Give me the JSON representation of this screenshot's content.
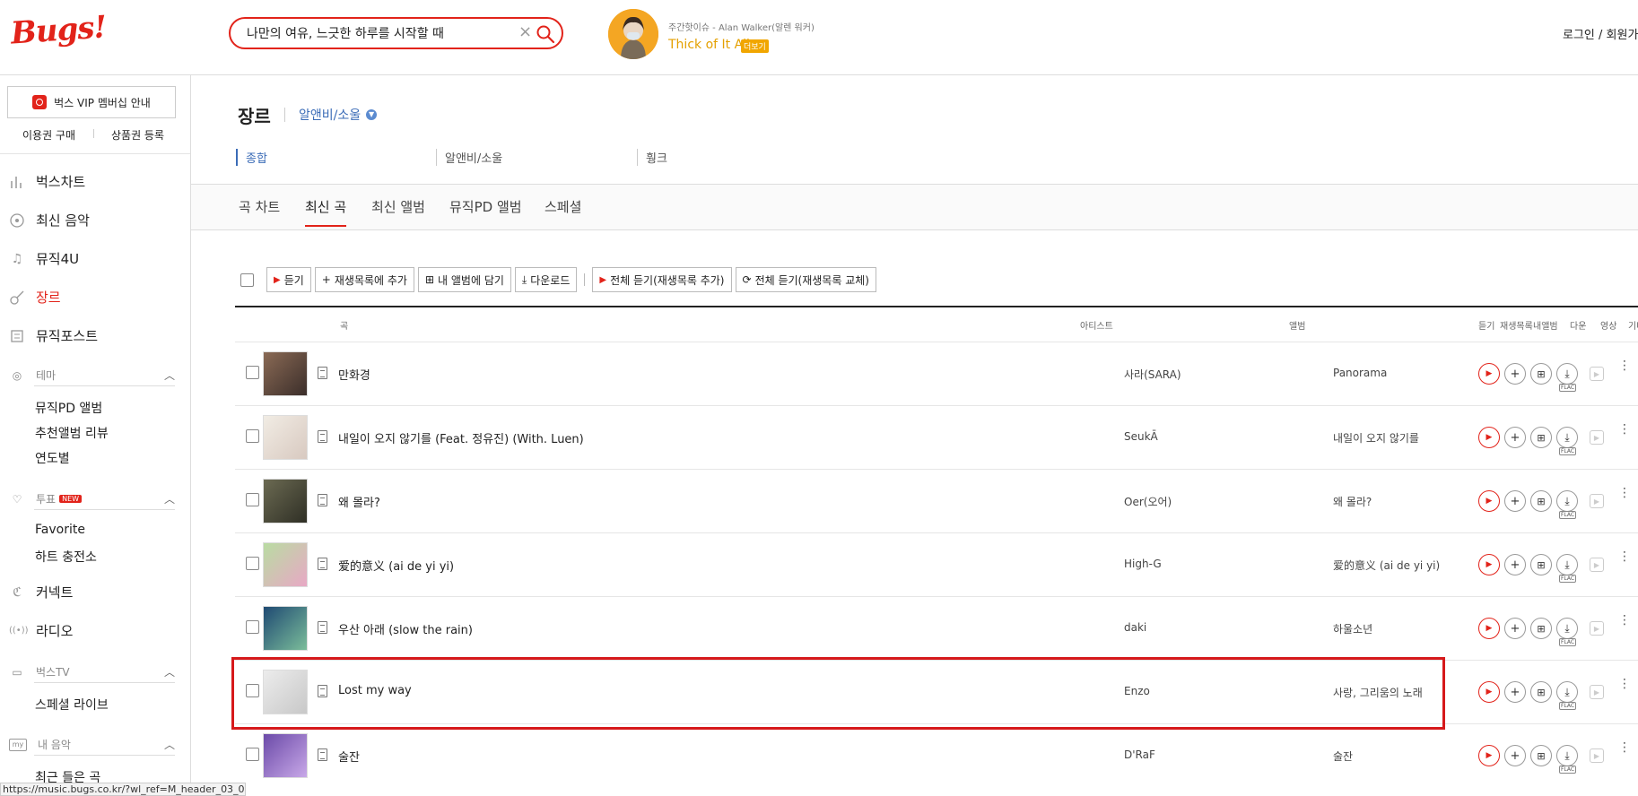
{
  "header": {
    "logo": "Bugs!",
    "search_value": "나만의 여유, 느긋한 하루를 시작할 때",
    "promo_sub": "주간핫이슈 - Alan Walker(알렌 워커)",
    "promo_title": "Thick of It All",
    "promo_more": "더보기",
    "login": "로그인 / 회원가입"
  },
  "sidebar": {
    "vip": "벅스 VIP 멤버십 안내",
    "purchase": "이용권 구매",
    "voucher": "상품권 등록",
    "menu": [
      {
        "label": "벅스차트",
        "icon": "chart-icon"
      },
      {
        "label": "최신 음악",
        "icon": "new-music-icon"
      },
      {
        "label": "뮤직4U",
        "icon": "note-icon"
      },
      {
        "label": "장르",
        "icon": "guitar-icon"
      },
      {
        "label": "뮤직포스트",
        "icon": "post-icon"
      }
    ],
    "theme": {
      "label": "테마",
      "items": [
        "뮤직PD 앨범",
        "추천앨범 리뷰",
        "연도별"
      ]
    },
    "vote": {
      "label": "투표",
      "badge": "NEW",
      "items": [
        "Favorite",
        "하트 충전소"
      ]
    },
    "connect": "커넥트",
    "radio": "라디오",
    "bugstv": {
      "label": "벅스TV",
      "items": [
        "스페셜 라이브"
      ]
    },
    "mymusic": {
      "label": "내 음악",
      "items": [
        "최근 들은 곡"
      ]
    },
    "status_url": "https://music.bugs.co.kr/?wl_ref=M_header_03_01"
  },
  "page": {
    "title": "장르",
    "genre": "알앤비/소울",
    "filters": [
      "종합",
      "알앤비/소울",
      "훵크"
    ],
    "tabs": [
      "곡 차트",
      "최신 곡",
      "최신 앨범",
      "뮤직PD 앨범",
      "스페셜"
    ]
  },
  "toolbar": {
    "listen": "듣기",
    "add_playlist": "재생목록에 추가",
    "add_album": "내 앨범에 담기",
    "download": "다운로드",
    "play_all_add": "전체 듣기(재생목록 추가)",
    "play_all_replace": "전체 듣기(재생목록 교체)"
  },
  "columns": {
    "song": "곡",
    "artist": "아티스트",
    "album": "앨범",
    "listen": "듣기",
    "playlist": "재생목록",
    "myalbum": "내앨범",
    "download": "다운",
    "video": "영상",
    "etc": "기타"
  },
  "tracks": [
    {
      "title": "만화경",
      "artist": "사라(SARA)",
      "album": "Panorama",
      "thumb": [
        "#8a6a55",
        "#3b2e2a"
      ]
    },
    {
      "title": "내일이 오지 않기를 (Feat. 정유진) (With. Luen)",
      "artist": "SeukĀ",
      "album": "내일이 오지 않기를",
      "thumb": [
        "#f1ece4",
        "#d8c9c0"
      ]
    },
    {
      "title": "왜 몰라?",
      "artist": "Oer(오어)",
      "album": "왜 몰라?",
      "thumb": [
        "#6b6a52",
        "#2f2f25"
      ]
    },
    {
      "title": "爱的意义 (ai de yi yi)",
      "artist": "High-G",
      "album": "爱的意义 (ai de yi yi)",
      "thumb": [
        "#b9dca2",
        "#e8a8c5"
      ]
    },
    {
      "title": "우산 아래 (slow the rain)",
      "artist": "daki",
      "album": "하울소년",
      "thumb": [
        "#1f4a73",
        "#7bbd9a"
      ]
    },
    {
      "title": "Lost my way",
      "artist": "Enzo",
      "album": "사랑, 그리움의 노래",
      "thumb": [
        "#ececec",
        "#c8c8c8"
      ]
    },
    {
      "title": "술잔",
      "artist": "D'RaF",
      "album": "술잔",
      "thumb": [
        "#6b4aa8",
        "#c8a8e8"
      ]
    }
  ],
  "download_badge": "FLAC",
  "colors": {
    "accent": "#e2231a",
    "link": "#3b6cb7",
    "promo": "#e4a000",
    "highlight": "#d6191b"
  }
}
